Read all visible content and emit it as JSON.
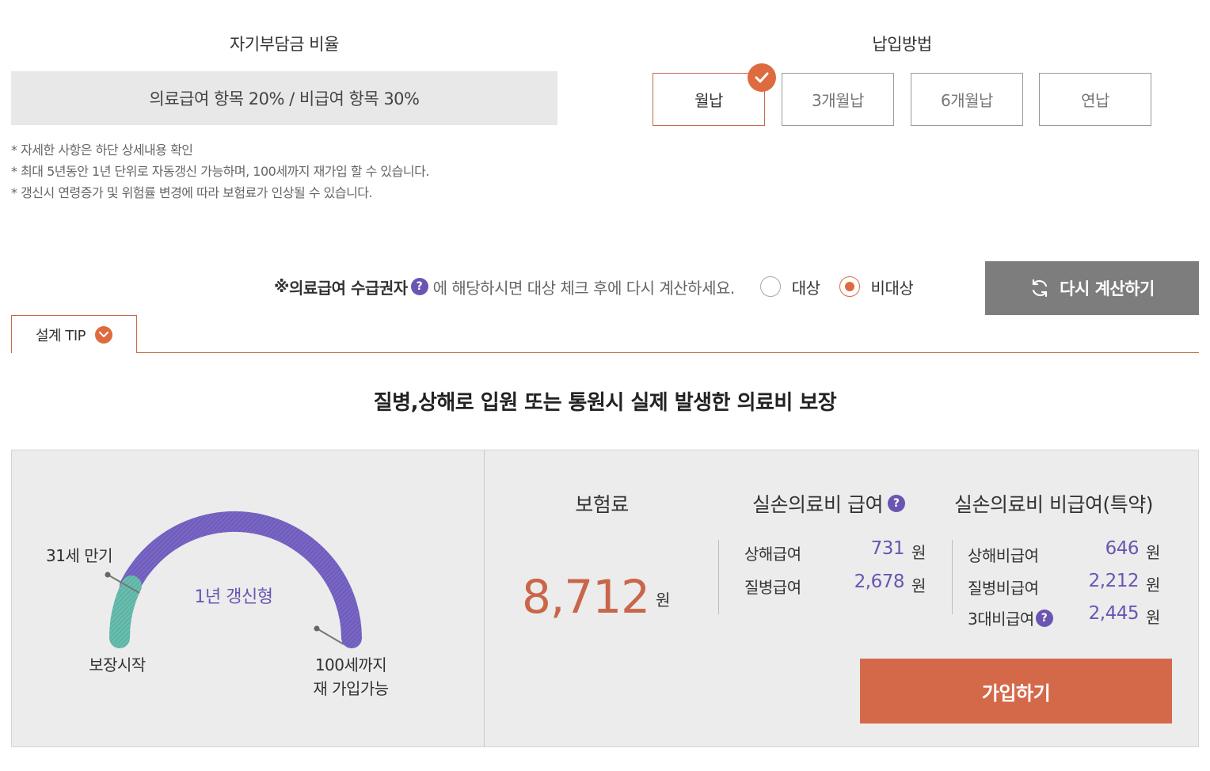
{
  "self_pay": {
    "title": "자기부담금 비율",
    "value": "의료급여 항목 20% / 비급여 항목 30%",
    "notes": [
      "* 자세한 사항은 하단 상세내용 확인",
      "* 최대 5년동안 1년 단위로 자동갱신 가능하며, 100세까지 재가입 할 수 있습니다.",
      "* 갱신시 연령증가 및 위험률 변경에 따라 보험료가 인상될 수 있습니다."
    ]
  },
  "payment": {
    "title": "납입방법",
    "options": [
      "월납",
      "3개월납",
      "6개월납",
      "연납"
    ],
    "selected": "월납"
  },
  "recipient": {
    "prefix": "※",
    "strong": "의료급여 수급권자",
    "text": "에 해당하시면 대상 체크 후에 다시 계산하세요.",
    "options": [
      "대상",
      "비대상"
    ],
    "selected": "비대상"
  },
  "recalc_label": "다시 계산하기",
  "tab_label": "설계 TIP",
  "headline": "질병,상해로 입원 또는 통원시 실제 발생한 의료비 보장",
  "gauge": {
    "center_label": "1년 갱신형",
    "start_label": "보장시작",
    "mid_label": "31세 만기",
    "end_label_1": "100세까지",
    "end_label_2": "재 가입가능"
  },
  "premium": {
    "title": "보험료",
    "value": "8,712",
    "unit": "원"
  },
  "covered": {
    "title": "실손의료비 급여",
    "rows": [
      {
        "label": "상해급여",
        "value": "731",
        "unit": "원"
      },
      {
        "label": "질병급여",
        "value": "2,678",
        "unit": "원"
      }
    ]
  },
  "noncovered": {
    "title": "실손의료비 비급여(특약)",
    "rows": [
      {
        "label": "상해비급여",
        "value": "646",
        "unit": "원"
      },
      {
        "label": "질병비급여",
        "value": "2,212",
        "unit": "원"
      },
      {
        "label": "3대비급여",
        "value": "2,445",
        "unit": "원"
      }
    ]
  },
  "join_label": "가입하기",
  "icons": {
    "help": "question-circle-icon",
    "check": "check-icon",
    "refresh": "refresh-icon",
    "chevron": "chevron-down-icon"
  },
  "colors": {
    "accent": "#dd6b3f",
    "purple": "#6a55b2",
    "teal": "#5cb3a4",
    "join": "#d4694a"
  }
}
